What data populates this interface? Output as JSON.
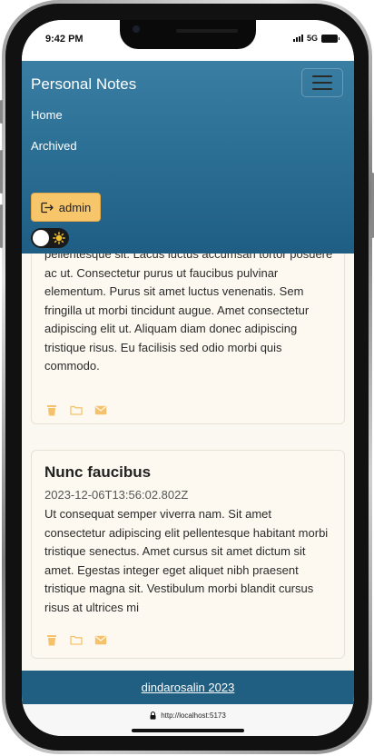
{
  "status": {
    "time": "9:42 PM",
    "network": "5G"
  },
  "header": {
    "brand": "Personal Notes",
    "nav": [
      {
        "label": "Home"
      },
      {
        "label": "Archived"
      }
    ],
    "user_button": "admin"
  },
  "notes": [
    {
      "title": "",
      "date": "",
      "body": "pellentesque sit. Lacus luctus accumsan tortor posuere ac ut. Consectetur purus ut faucibus pulvinar elementum. Purus sit amet luctus venenatis. Sem fringilla ut morbi tincidunt augue. Amet consectetur adipiscing elit ut. Aliquam diam donec adipiscing tristique risus. Eu facilisis sed odio morbi quis commodo."
    },
    {
      "title": "Nunc faucibus",
      "date": "2023-12-06T13:56:02.802Z",
      "body": "Ut consequat semper viverra nam. Sit amet consectetur adipiscing elit pellentesque habitant morbi tristique senectus. Amet cursus sit amet dictum sit amet. Egestas integer eget aliquet nibh praesent tristique magna sit. Vestibulum morbi blandit cursus risus at ultrices mi"
    }
  ],
  "footer": {
    "credit": "dindarosalin 2023"
  },
  "browser": {
    "url": "http://localhost:5173"
  },
  "icons": {
    "delete": "trash-icon",
    "archive": "folder-icon",
    "unarchive": "envelope-icon",
    "logout": "logout-icon",
    "theme": "sun-icon"
  },
  "colors": {
    "header": "#2b6e94",
    "footer": "#215f82",
    "accent": "#f8c66a",
    "page": "#fbf8f2",
    "action_icon": "#f5c26b"
  }
}
